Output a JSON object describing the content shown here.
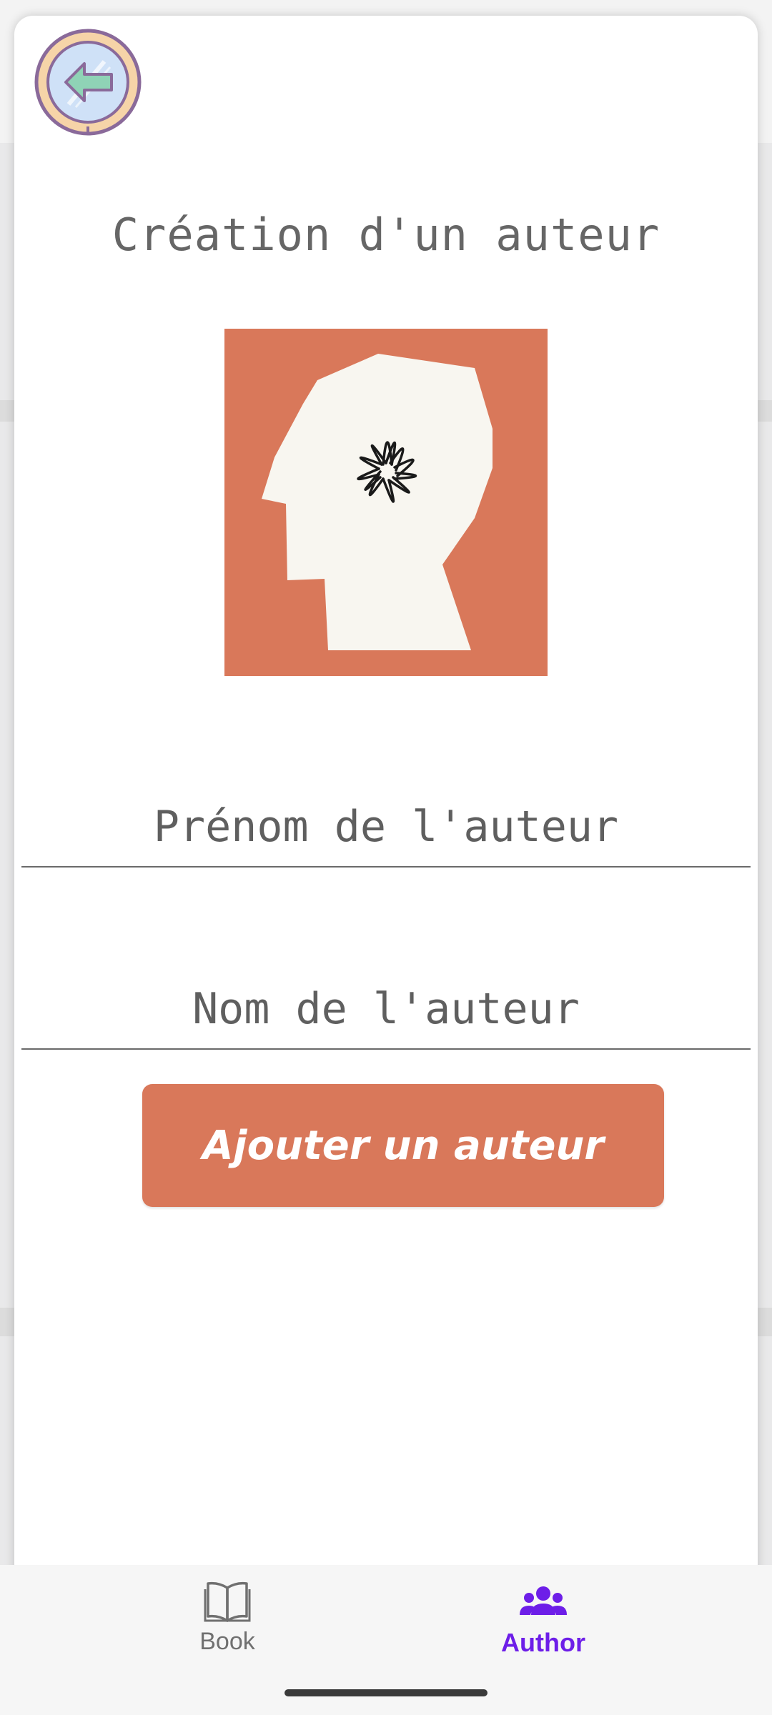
{
  "header": {
    "back_icon": "arrow-left-circle-icon"
  },
  "form": {
    "title": "Création d'un auteur",
    "illustration": "author-head-illustration",
    "firstname_placeholder": "Prénom de l'auteur",
    "firstname_value": "",
    "lastname_placeholder": "Nom de l'auteur",
    "lastname_value": "",
    "submit_label": "Ajouter un auteur",
    "accent_color": "#d9785a"
  },
  "bottom_nav": {
    "items": [
      {
        "label": "Book",
        "icon": "book-icon",
        "active": false
      },
      {
        "label": "Author",
        "icon": "group-icon",
        "active": true
      }
    ],
    "active_color": "#6d1ee8"
  }
}
